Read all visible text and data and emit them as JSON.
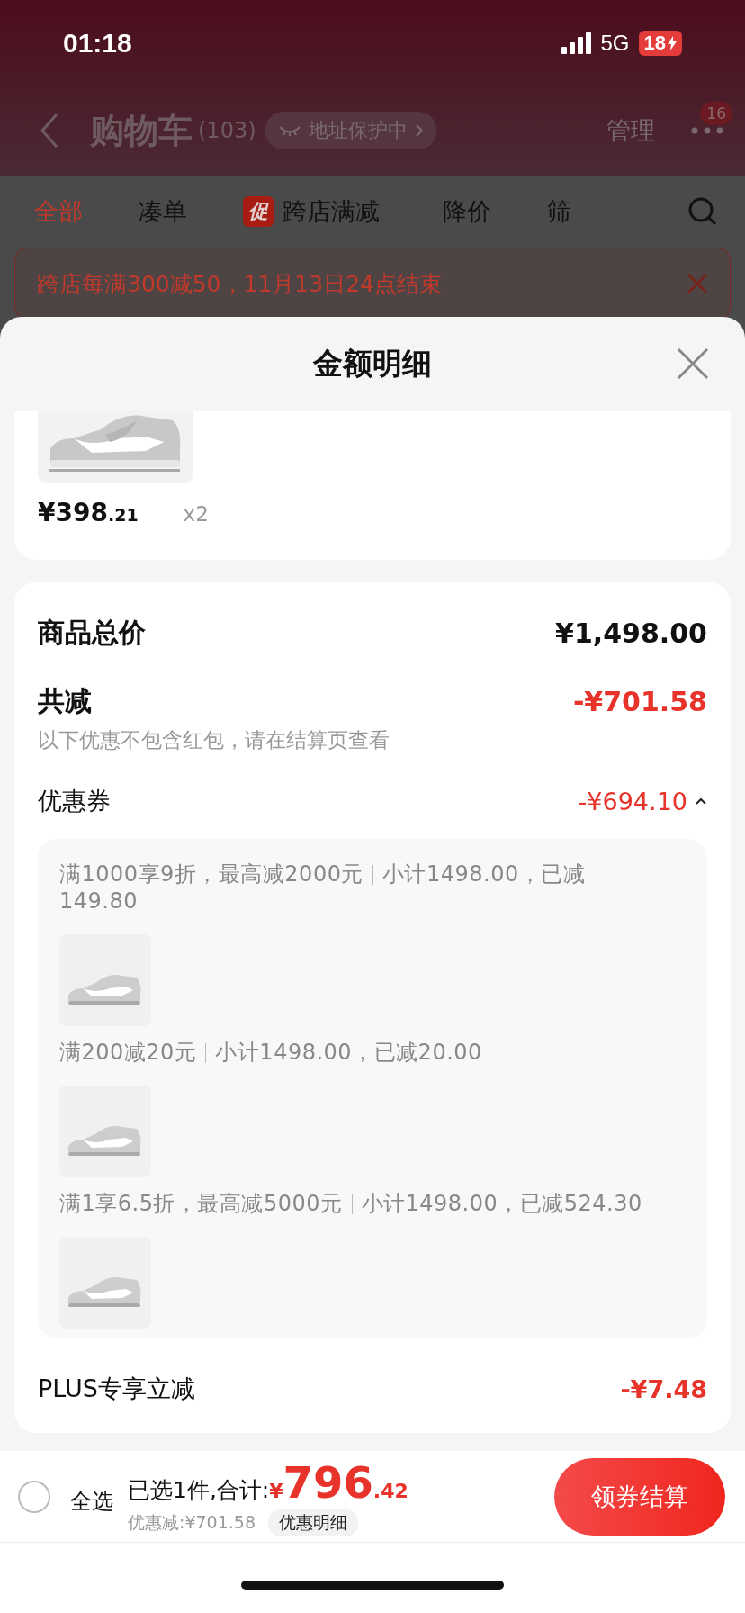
{
  "status_bar": {
    "time": "01:18",
    "network": "5G",
    "battery": "18"
  },
  "header": {
    "title": "购物车",
    "count": "(103)",
    "address_badge": "地址保护中",
    "manage": "管理",
    "notification_count": "16"
  },
  "tabs": [
    {
      "label": "全部",
      "selected": true
    },
    {
      "label": "凑单",
      "selected": false
    },
    {
      "label": "跨店满减",
      "badge": "促",
      "selected": false
    },
    {
      "label": "降价",
      "selected": false
    },
    {
      "label": "筛",
      "selected": false
    }
  ],
  "promo_banner": "跨店每满300减50，11月13日24点结束",
  "sheet": {
    "title": "金额明细",
    "product": {
      "price_main": "¥398",
      "price_decimal": ".21",
      "quantity": "x2"
    },
    "summary": [
      {
        "label": "商品总价",
        "amount": "¥1,498.00",
        "kind": "total"
      },
      {
        "label": "共减",
        "amount": "-¥701.58",
        "kind": "discount_total",
        "note": "以下优惠不包含红包，请在结算页查看"
      },
      {
        "label": "优惠券",
        "amount": "-¥694.10",
        "kind": "coupon",
        "expanded": true
      }
    ],
    "coupons": [
      {
        "rule": "满1000享9折，最高减2000元",
        "detail": "小计1498.00，已减149.80"
      },
      {
        "rule": "满200减20元",
        "detail": "小计1498.00，已减20.00"
      },
      {
        "rule": "满1享6.5折，最高减5000元",
        "detail": "小计1498.00，已减524.30"
      }
    ],
    "plus": {
      "label": "PLUS专享立减",
      "amount": "-¥7.48"
    }
  },
  "bottom_bar": {
    "select_all": {
      "label": "全选",
      "checked": false
    },
    "selected_text": "已选1件,合计:",
    "total_symbol": "¥",
    "total_main": "796",
    "total_decimal": ".42",
    "discount": "优惠减:¥701.58",
    "detail_button": "优惠明细",
    "checkout_button": "领券结算"
  }
}
